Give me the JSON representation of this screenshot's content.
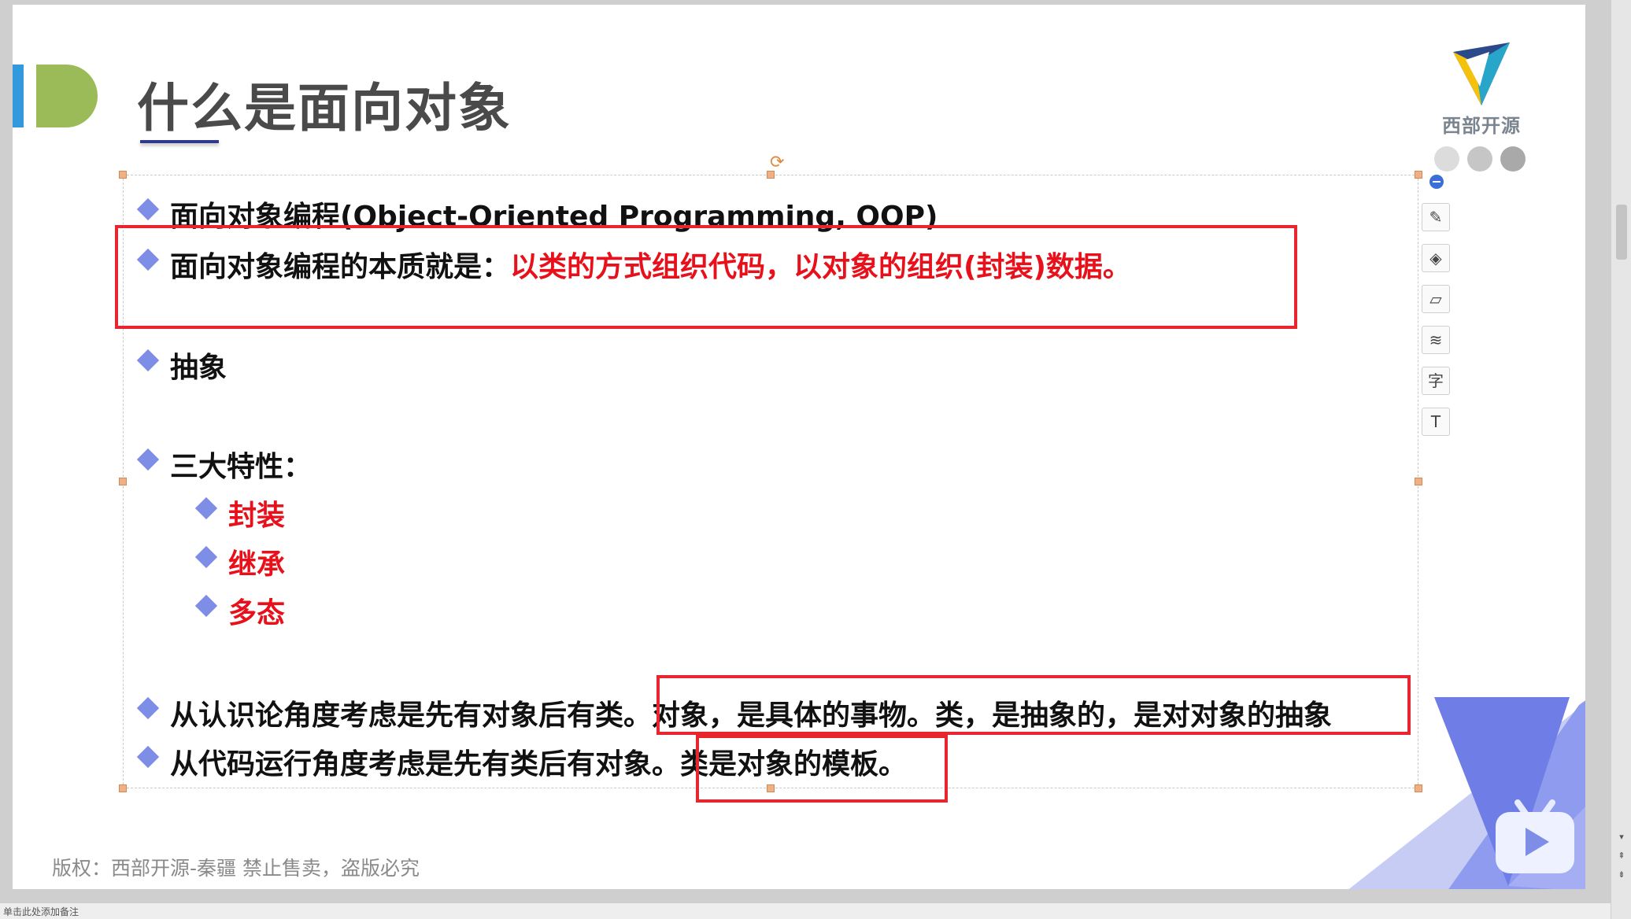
{
  "slide": {
    "title": "什么是面向对象",
    "logo_text": "西部开源",
    "footer": "版权：西部开源-秦疆    禁止售卖，盗版必究",
    "bullets": {
      "b1": "面向对象编程(Object-Oriented Programming, OOP)",
      "b2_black": "面向对象编程的本质就是：",
      "b2_red": "以类的方式组织代码，以对象的组织(封装)数据。",
      "b3": "抽象",
      "b4": "三大特性：",
      "sub1": "封装",
      "sub2": "继承",
      "sub3": "多态",
      "b5_a": "从认识论角度考虑是先有对象后有类。",
      "b5_b": "对象，是具体的事物。类，是抽象的，是对对象的抽象",
      "b6_a": "从代码运行角度考虑是先有类后有对象。",
      "b6_b": "类是对象的模板。"
    }
  },
  "status": {
    "text": "单击此处添加备注"
  },
  "colors": {
    "accent_blue": "#3399dd",
    "accent_green": "#9bbb59",
    "bullet_diamond": "#7e8ee6",
    "emphasis_red": "#e8101a",
    "highlight_box": "#e8262e"
  },
  "icons": {
    "tools": [
      "edit-shape-icon",
      "fill-icon",
      "outline-icon",
      "layers-icon",
      "text-style-icon",
      "text-effect-icon"
    ]
  }
}
